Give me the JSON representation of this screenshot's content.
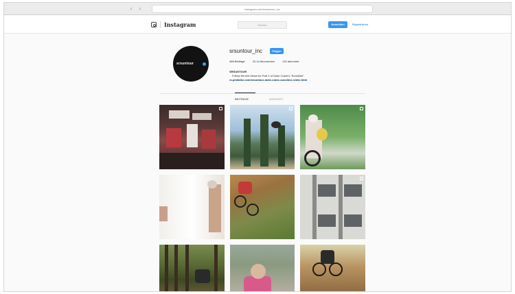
{
  "browser": {
    "url": "instagram.com/srsuntour_inc",
    "back_icon": "chevron-left-icon",
    "forward_icon": "chevron-right-icon"
  },
  "instagram": {
    "wordmark": "Instagram",
    "search_placeholder": "Suchen",
    "login_label": "Anmelden",
    "signup_label": "Registrieren"
  },
  "profile": {
    "avatar_text": "srsuntour",
    "username": "srsuntour_inc",
    "follow_label": "Folgen",
    "stats": {
      "posts": "488 Beiträge",
      "followers": "22,1k Abonnenten",
      "following": "115 abonniert"
    },
    "bio_name": "SRSUNTOUR",
    "bio_line": "Follow the link below for Part 1 of Duke Crane's \"Sunshine\"",
    "bio_link": "rs.pinkbike.com/srsuntour-duke-crane-sunshine-video.html"
  },
  "tabs": {
    "posts": "BEITRÄGE",
    "tagged": "MARKIERT"
  },
  "accent_color": "#3897f0"
}
